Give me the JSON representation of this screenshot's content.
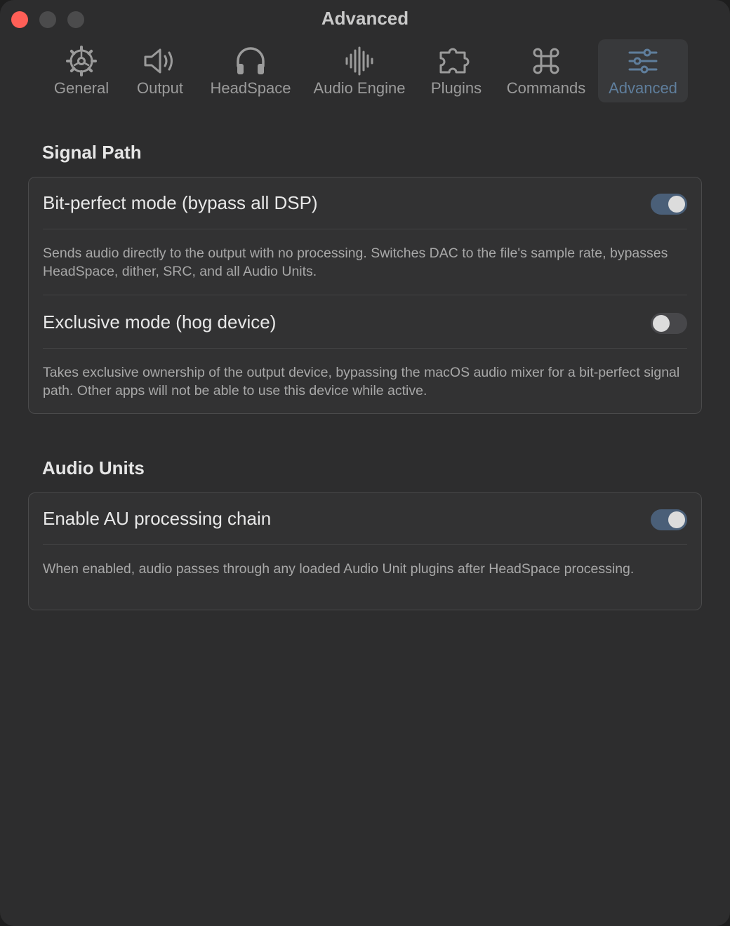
{
  "window": {
    "title": "Advanced"
  },
  "toolbar": {
    "tabs": [
      {
        "label": "General",
        "icon": "gear-icon"
      },
      {
        "label": "Output",
        "icon": "speaker-icon"
      },
      {
        "label": "HeadSpace",
        "icon": "headphones-icon"
      },
      {
        "label": "Audio Engine",
        "icon": "waveform-icon"
      },
      {
        "label": "Plugins",
        "icon": "puzzle-icon"
      },
      {
        "label": "Commands",
        "icon": "command-icon"
      },
      {
        "label": "Advanced",
        "icon": "sliders-icon",
        "selected": true
      }
    ]
  },
  "signal_path": {
    "heading": "Signal Path",
    "bit_perfect": {
      "label": "Bit-perfect mode (bypass all DSP)",
      "enabled": true,
      "description": "Sends audio directly to the output with no processing. Switches DAC to the file's sample rate, bypasses HeadSpace, dither, SRC, and all Audio Units."
    },
    "exclusive": {
      "label": "Exclusive mode (hog device)",
      "enabled": false,
      "description": "Takes exclusive ownership of the output device, bypassing the macOS audio mixer for a bit-perfect signal path. Other apps will not be able to use this device while active."
    }
  },
  "audio_units": {
    "heading": "Audio Units",
    "au_chain": {
      "label": "Enable AU processing chain",
      "enabled": true,
      "description": "When enabled, audio passes through any loaded Audio Unit plugins after HeadSpace processing."
    }
  },
  "colors": {
    "accent": "#5f7e9c",
    "toggle_on": "#4a5f78",
    "close_button": "#ff5f57"
  }
}
